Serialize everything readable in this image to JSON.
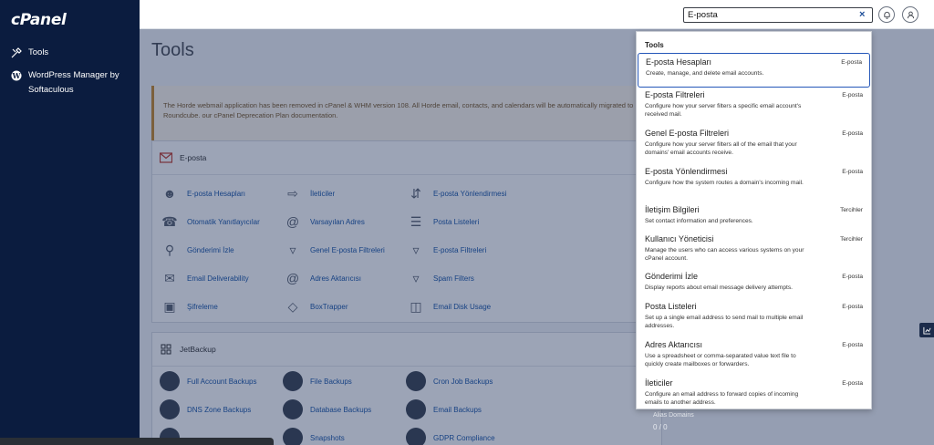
{
  "sidebar": {
    "logo": "cPanel",
    "items": [
      {
        "label": "Tools"
      },
      {
        "label": "WordPress Manager by Softaculous"
      }
    ]
  },
  "topbar": {
    "search_value": "E-posta",
    "clear_symbol": "×"
  },
  "main": {
    "title": "Tools",
    "notice": "The Horde webmail application has been removed in cPanel & WHM version 108. All Horde email, contacts, and calendars will be automatically migrated to Roundcube. our cPanel Deprecation Plan documentation.",
    "email_section": {
      "title": "E-posta",
      "tools": [
        "E-posta Hesapları",
        "İleticiler",
        "E-posta Yönlendirmesi",
        "Otomatik Yanıtlayıcılar",
        "Varsayılan Adres",
        "Posta Listeleri",
        "Gönderimi İzle",
        "Genel E-posta Filtreleri",
        "E-posta Filtreleri",
        "Email Deliverability",
        "Adres Aktarıcısı",
        "Spam Filters",
        "Şifreleme",
        "BoxTrapper",
        "Email Disk Usage"
      ]
    },
    "jet_section": {
      "title": "JetBackup",
      "tools": [
        "Full Account Backups",
        "File Backups",
        "Cron Job Backups",
        "DNS Zone Backups",
        "Database Backups",
        "Email Backups",
        "",
        "Snapshots",
        "GDPR Compliance"
      ]
    },
    "peek_alias_label": "Alias Domains",
    "peek_alias_value": "0 / 0"
  },
  "dropdown": {
    "heading": "Tools",
    "results": [
      {
        "title": "E-posta Hesapları",
        "desc": "Create, manage, and delete email accounts.",
        "cat": "E-posta"
      },
      {
        "title": "E-posta Filtreleri",
        "desc": "Configure how your server filters a specific email account's received mail.",
        "cat": "E-posta"
      },
      {
        "title": "Genel E-posta Filtreleri",
        "desc": "Configure how your server filters all of the email that your domains' email accounts receive.",
        "cat": "E-posta"
      },
      {
        "title": "E-posta Yönlendirmesi",
        "desc": "Configure how the system routes a domain's incoming mail.",
        "cat": "E-posta"
      },
      {
        "title": "İletişim Bilgileri",
        "desc": "Set contact information and preferences.",
        "cat": "Tercihler"
      },
      {
        "title": "Kullanıcı Yöneticisi",
        "desc": "Manage the users who can access various systems on your cPanel account.",
        "cat": "Tercihler"
      },
      {
        "title": "Gönderimi İzle",
        "desc": "Display reports about email message delivery attempts.",
        "cat": "E-posta"
      },
      {
        "title": "Posta Listeleri",
        "desc": "Set up a single email address to send mail to multiple email addresses.",
        "cat": "E-posta"
      },
      {
        "title": "Adres Aktarıcısı",
        "desc": "Use a spreadsheet or comma-separated value text file to quickly create mailboxes or forwarders.",
        "cat": "E-posta"
      },
      {
        "title": "İleticiler",
        "desc": "Configure an email address to forward copies of incoming emails to another address.",
        "cat": "E-posta"
      }
    ]
  }
}
